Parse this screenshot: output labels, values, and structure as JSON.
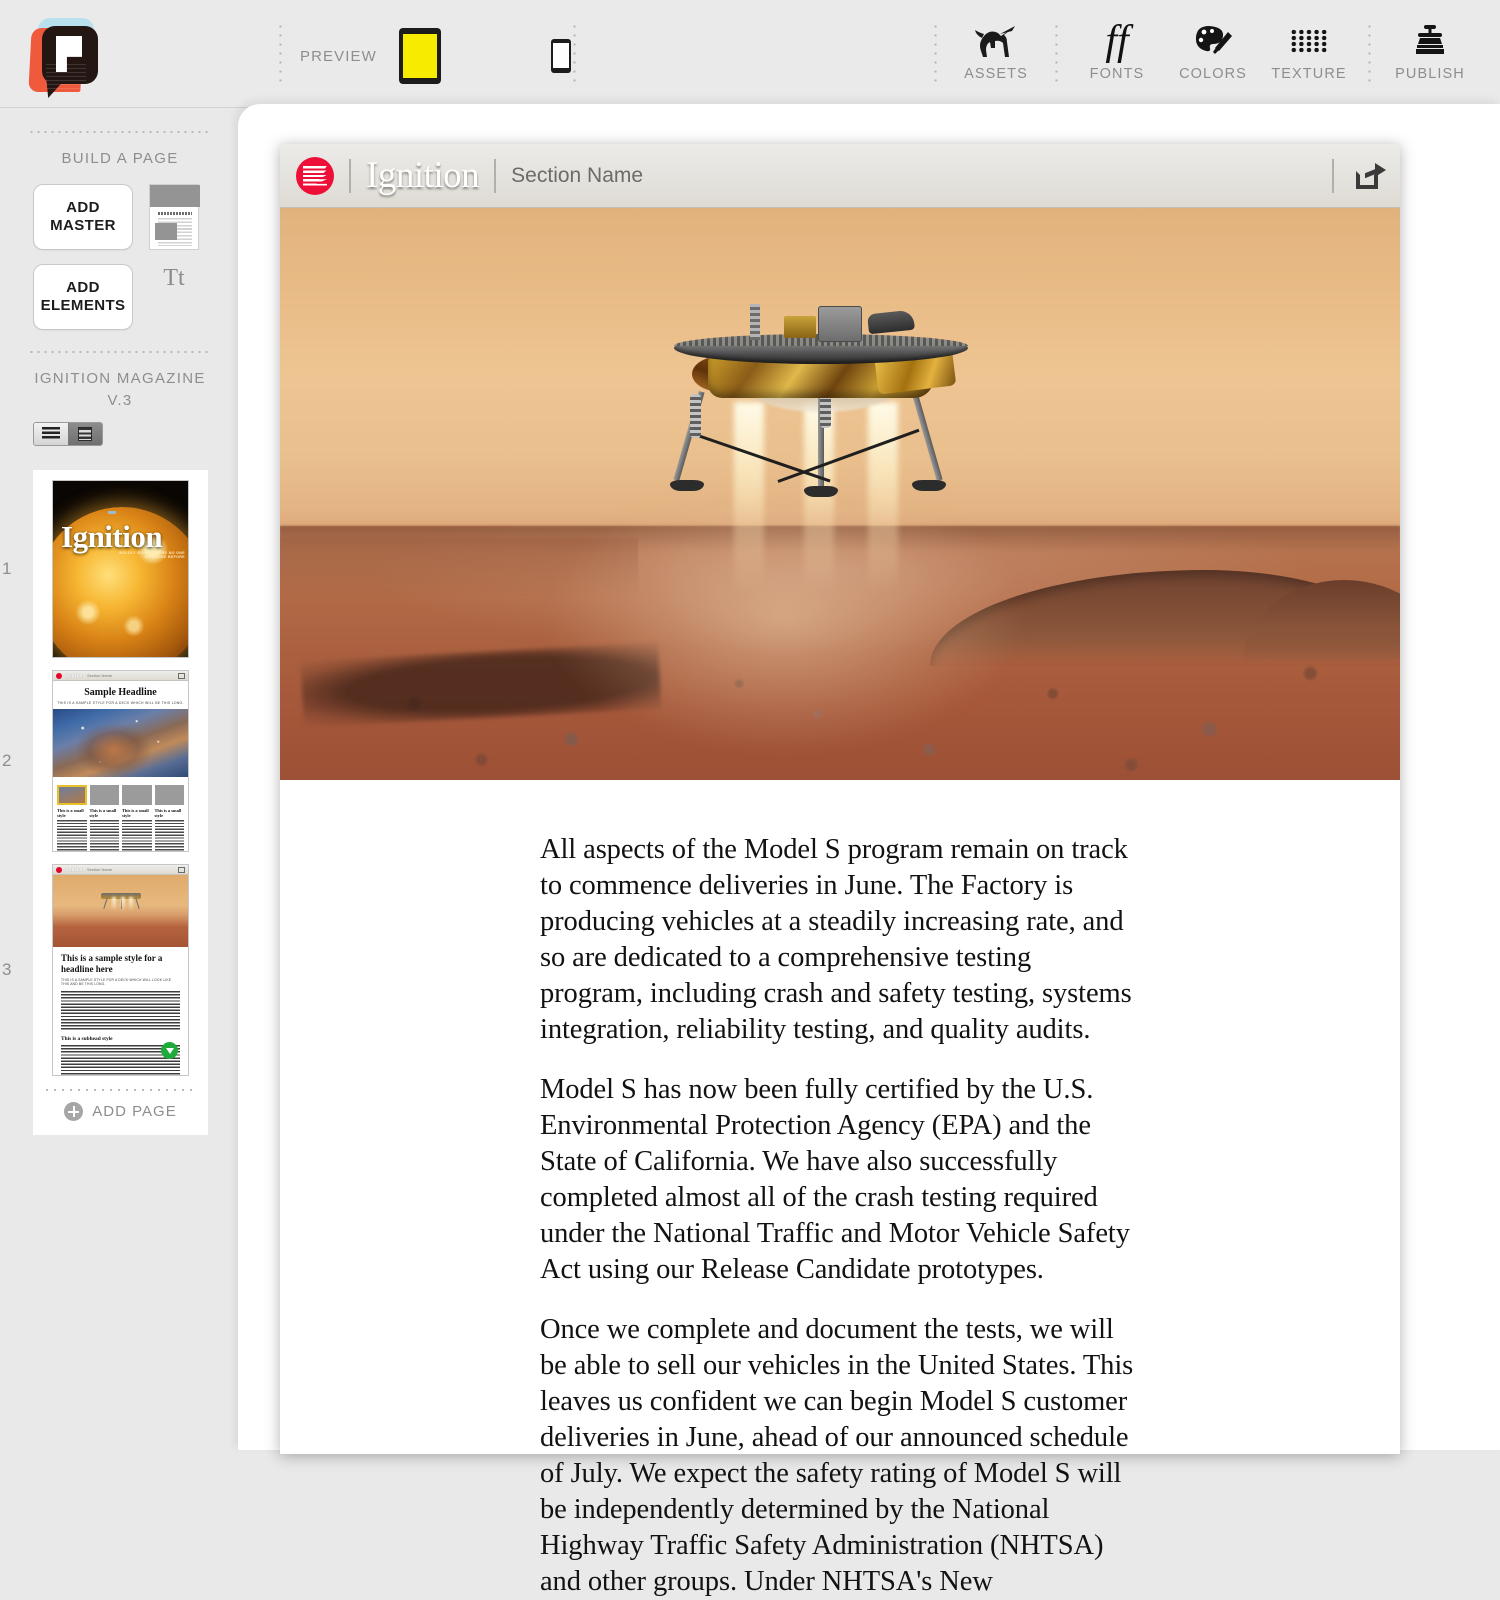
{
  "topbar": {
    "logo_name": "padstack-logo",
    "preview_label": "PREVIEW",
    "devices": [
      {
        "name": "tablet",
        "state": "active"
      },
      {
        "name": "desktop",
        "state": "selected"
      },
      {
        "name": "phone",
        "state": "inactive"
      }
    ],
    "tools": [
      {
        "icon": "unicorn-icon",
        "label": "ASSETS"
      },
      {
        "icon": "ff-ligature-icon",
        "label": "FONTS"
      },
      {
        "icon": "palette-brush-icon",
        "label": "COLORS"
      },
      {
        "icon": "dot-grid-icon",
        "label": "TEXTURE"
      },
      {
        "icon": "stamp-press-icon",
        "label": "PUBLISH"
      }
    ]
  },
  "sidebar": {
    "build_title": "BUILD A PAGE",
    "add_master_label": "ADD MASTER",
    "add_elements_label": "ADD ELEMENTS",
    "elements_tt_label": "Tt",
    "project_title": "IGNITION MAGAZINE",
    "project_version": "V.3",
    "view_modes": [
      {
        "name": "list-view",
        "active": false
      },
      {
        "name": "detail-view",
        "active": true
      }
    ],
    "pages": [
      {
        "number": "1",
        "kind": "cover",
        "title": "Ignition",
        "tagline": "BOLDLY GOING WHERE NO ONE HAS GONE BEFORE"
      },
      {
        "number": "2",
        "kind": "feature",
        "headline": "Sample Headline",
        "deck": "THIS IS A SAMPLE STYLE FOR A DECK WHICH WILL BE THIS LONG.",
        "column_heads": [
          "This is a small style",
          "This is a small style",
          "This is a small style",
          "This is a small style"
        ]
      },
      {
        "number": "3",
        "kind": "article",
        "headline": "This is a sample style for a headline here",
        "deck": "THIS IS A SAMPLE STYLE FOR A DECK WHICH WILL LOOK LIKE THIS AND BE THIS LONG.",
        "subhead": "This is a subhead style"
      }
    ],
    "add_page_label": "ADD PAGE"
  },
  "page_header": {
    "logo_name": "ignition-mark",
    "title": "Ignition",
    "section": "Section Name",
    "share_icon": "share-icon"
  },
  "hero": {
    "alt": "Mars lander descending with retrorockets firing over rusty terrain"
  },
  "article": {
    "paragraphs": [
      "All aspects of the Model S program remain on track to commence deliveries in June. The Factory is producing vehicles at a steadily increasing rate, and so are dedicated to a comprehensive testing program, including crash and safety testing, systems integration, reliability testing, and quality audits.",
      "Model S has now been fully certified by the U.S. Environmental Protection Agency (EPA) and the State of California. We have also successfully completed almost all of the crash testing required under the National Traffic and Motor Vehicle Safety Act using our Release Candidate prototypes.",
      "Once we complete and document the tests, we will be able to sell our vehicles in the United States. This leaves us confident we can begin Model S customer deliveries in June, ahead of our announced schedule of July. We expect the safety rating of Model S will be independently determined by the National Highway Traffic Safety Administration (NHTSA) and other groups. Under NHTSA's New"
    ]
  },
  "colors": {
    "chrome_bg": "#e9e9e9",
    "accent_yellow": "#f7ec00",
    "brand_red": "#ed0f37",
    "logo_orange": "#ef5a3c",
    "logo_blue": "#b9e0ee",
    "green_badge": "#1faa3c",
    "muted_text": "#8e8e8e"
  }
}
